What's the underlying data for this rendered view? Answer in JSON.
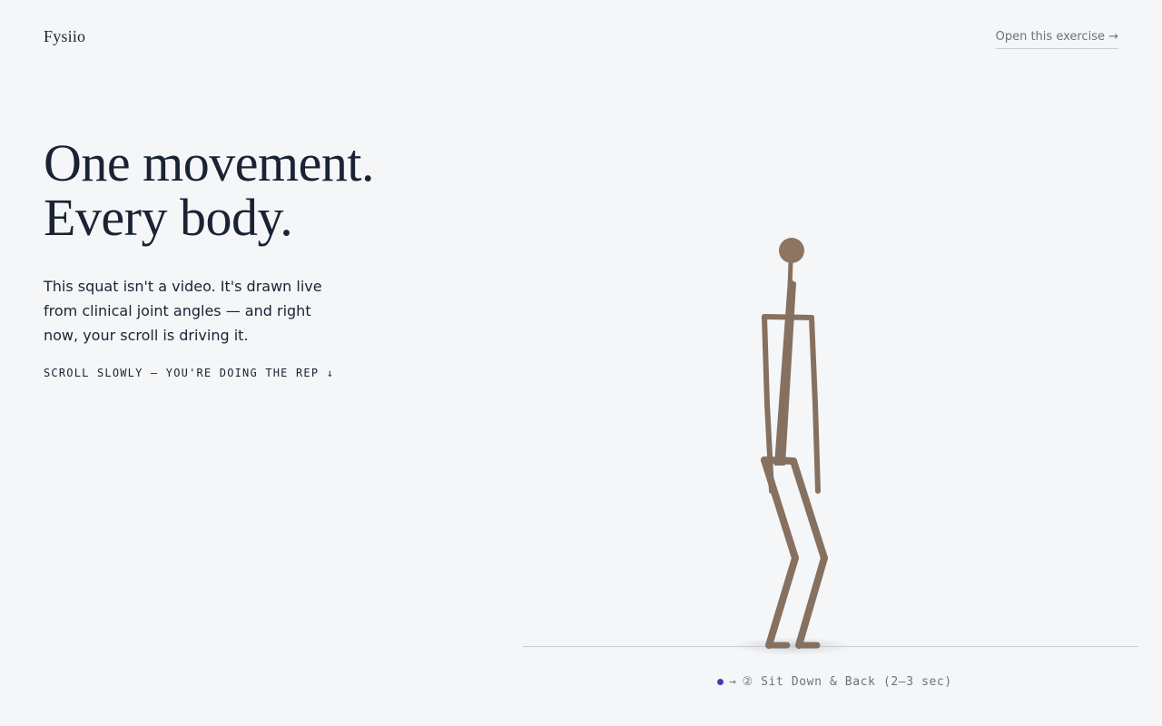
{
  "brand": {
    "name": "Fysiio"
  },
  "nav": {
    "open_exercise": "Open this exercise →"
  },
  "hero": {
    "headline_line1": "One movement.",
    "headline_line2": "Every body.",
    "lede": "This squat isn't a video. It's drawn live from clinical joint angles — and right now, your scroll is driving it.",
    "hint": "SCROLL SLOWLY — YOU'RE DOING THE REP ↓"
  },
  "figure": {
    "step_arrow": "→",
    "step_label": "② Sit Down & Back (2–3 sec)",
    "colors": {
      "body": "#86705f",
      "head": "#8f7561",
      "floor": "#c9ced6",
      "indicator": "#3b3fb0"
    }
  }
}
